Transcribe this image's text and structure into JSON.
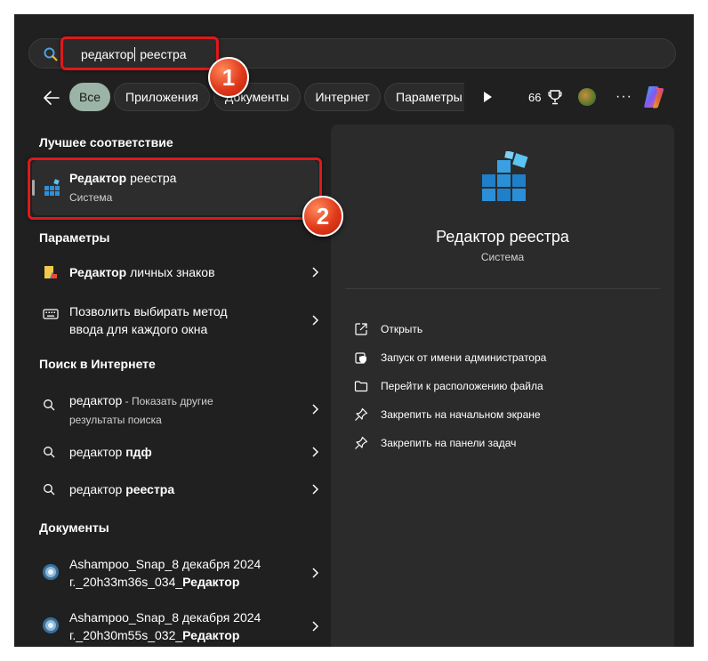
{
  "search": {
    "query_bold": "редактор",
    "query_rest": " реестра"
  },
  "filters": {
    "items": [
      "Все",
      "Приложения",
      "Документы",
      "Интернет",
      "Параметры"
    ],
    "points": "66"
  },
  "best_match": {
    "heading": "Лучшее соответствие",
    "title_bold": "Редактор",
    "title_rest": " реестра",
    "subtitle": "Система"
  },
  "settings_section": {
    "heading": "Параметры",
    "items": [
      {
        "bold": "Редактор",
        "rest": " личных знаков"
      },
      {
        "line1": "Позволить выбирать метод",
        "line2": "ввода для каждого окна"
      }
    ]
  },
  "web_section": {
    "heading": "Поиск в Интернете",
    "items": [
      {
        "term": "редактор",
        "suffix": " - Показать другие",
        "line2": "результаты поиска"
      },
      {
        "term": "редактор ",
        "bold": "пдф"
      },
      {
        "term": "редактор ",
        "bold": "реестра"
      }
    ]
  },
  "docs_section": {
    "heading": "Документы",
    "items": [
      {
        "line1": "Ashampoo_Snap_8 декабря 2024",
        "line2_pre": "г._20h33m36s_034_",
        "line2_bold": "Редактор"
      },
      {
        "line1": "Ashampoo_Snap_8 декабря 2024",
        "line2_pre": "г._20h30m55s_032_",
        "line2_bold": "Редактор"
      }
    ]
  },
  "details": {
    "title": "Редактор реестра",
    "subtitle": "Система",
    "actions": [
      {
        "label": "Открыть",
        "icon": "open-external-icon"
      },
      {
        "label": "Запуск от имени администратора",
        "icon": "shield-icon"
      },
      {
        "label": "Перейти к расположению файла",
        "icon": "folder-icon"
      },
      {
        "label": "Закрепить на начальном экране",
        "icon": "pin-icon"
      },
      {
        "label": "Закрепить на панели задач",
        "icon": "pin-icon"
      }
    ]
  },
  "annotations": {
    "badge1": "1",
    "badge2": "2"
  },
  "colors": {
    "highlight": "#e0181a",
    "active_filter": "#9bb4a7",
    "panel_bg": "#202020"
  }
}
